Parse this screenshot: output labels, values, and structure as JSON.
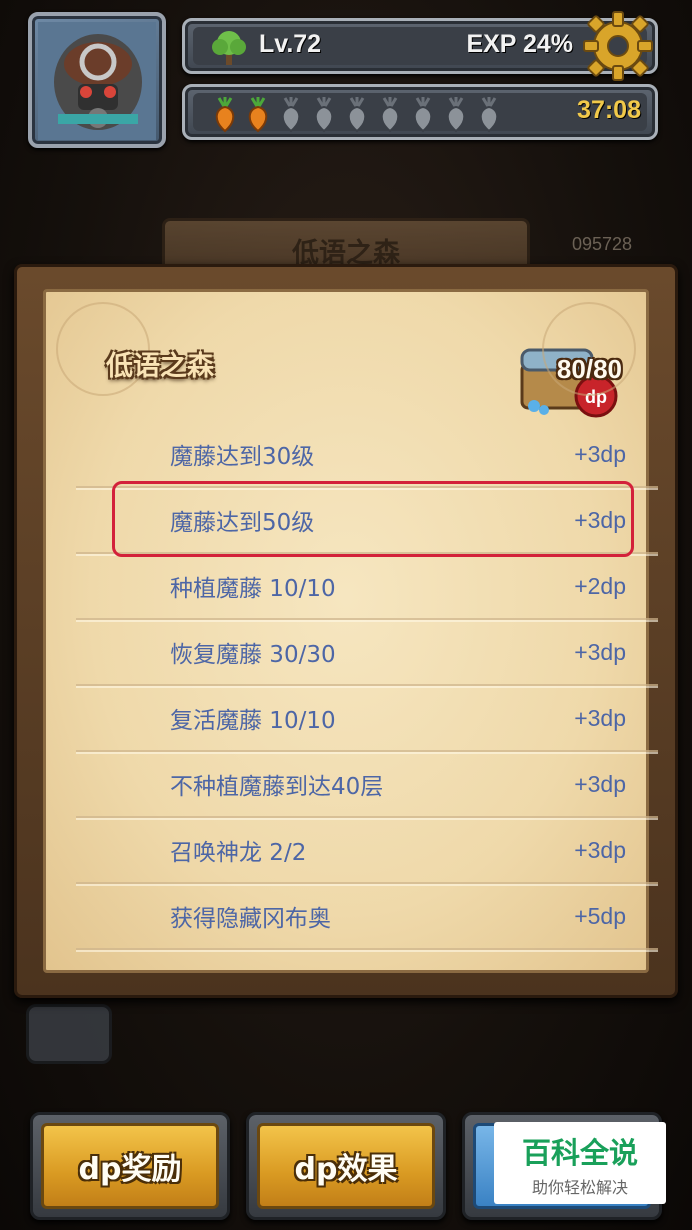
{
  "hud": {
    "level_label": "Lv.72",
    "exp_label": "EXP 24%",
    "exp_progress": 0.24,
    "timer": "37:08",
    "energy_full": 2,
    "energy_total": 9
  },
  "map": {
    "header_title": "低语之森",
    "score_number": "095728"
  },
  "panel": {
    "title": "低语之森",
    "dp_count": "80/80",
    "tasks": [
      {
        "name": "魔藤达到30级",
        "reward": "+3dp"
      },
      {
        "name": "魔藤达到50级",
        "reward": "+3dp",
        "highlighted": true
      },
      {
        "name": "种植魔藤 10/10",
        "reward": "+2dp"
      },
      {
        "name": "恢复魔藤 30/30",
        "reward": "+3dp"
      },
      {
        "name": "复活魔藤 10/10",
        "reward": "+3dp"
      },
      {
        "name": "不种植魔藤到达40层",
        "reward": "+3dp"
      },
      {
        "name": "召唤神龙 2/2",
        "reward": "+3dp"
      },
      {
        "name": "获得隐藏冈布奥",
        "reward": "+5dp"
      }
    ]
  },
  "buttons": {
    "dp_reward": "dp奖励",
    "dp_effect": "dp效果"
  },
  "watermark": {
    "main": "百科全说",
    "sub": "助你轻松解决"
  },
  "colors": {
    "task_text": "#4d66a6",
    "highlight_border": "#d3213a",
    "button_gold": "#e0a42c",
    "timer_gold": "#f1c94a"
  },
  "icons": [
    "gear-icon",
    "tree-icon",
    "carrot-icon",
    "treasure-chest-icon",
    "dp-badge-icon"
  ]
}
